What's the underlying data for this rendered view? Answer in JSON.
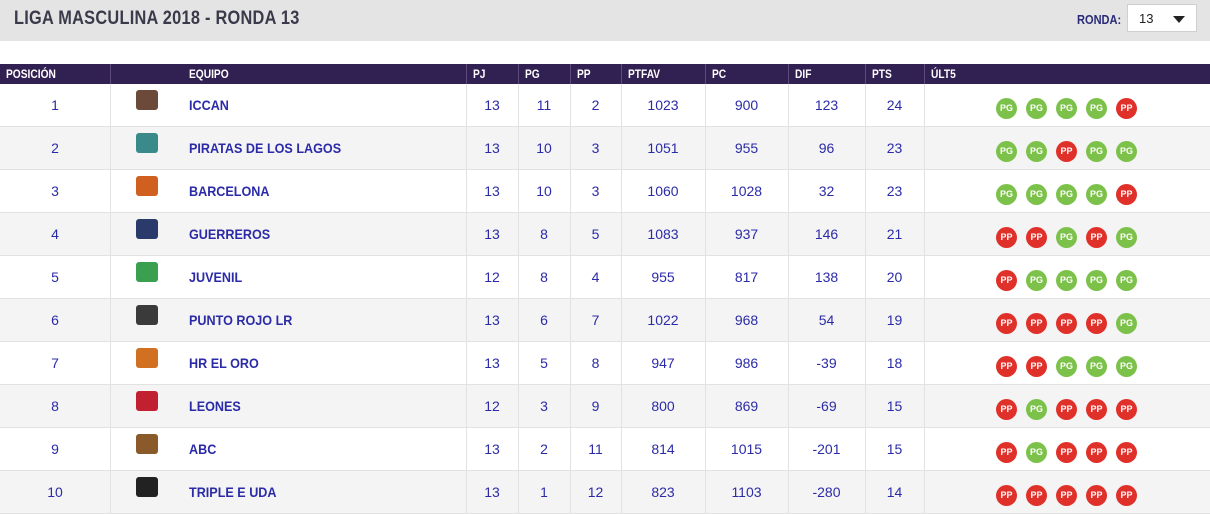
{
  "header": {
    "title": "LIGA MASCULINA 2018 - RONDA 13",
    "ronda_label": "RONDA:",
    "ronda_value": "13"
  },
  "columns": [
    "POSICIÓN",
    "EQUIPO",
    "PJ",
    "PG",
    "PP",
    "PTFAV",
    "PC",
    "DIF",
    "PTS",
    "ÚLT5"
  ],
  "colors": {
    "header_bg": "#312052",
    "link": "#2b2ba8",
    "win": "#7cc24a",
    "loss": "#e0302a"
  },
  "rows": [
    {
      "pos": "1",
      "team": "ICCAN",
      "pj": "13",
      "pg": "11",
      "pp": "2",
      "ptfav": "1023",
      "pc": "900",
      "dif": "123",
      "pts": "24",
      "last5": [
        "PG",
        "PG",
        "PG",
        "PG",
        "PP"
      ],
      "logo_color": "#6b4a3a"
    },
    {
      "pos": "2",
      "team": "PIRATAS DE LOS LAGOS",
      "pj": "13",
      "pg": "10",
      "pp": "3",
      "ptfav": "1051",
      "pc": "955",
      "dif": "96",
      "pts": "23",
      "last5": [
        "PG",
        "PG",
        "PP",
        "PG",
        "PG"
      ],
      "logo_color": "#3a8a8a"
    },
    {
      "pos": "3",
      "team": "BARCELONA",
      "pj": "13",
      "pg": "10",
      "pp": "3",
      "ptfav": "1060",
      "pc": "1028",
      "dif": "32",
      "pts": "23",
      "last5": [
        "PG",
        "PG",
        "PG",
        "PG",
        "PP"
      ],
      "logo_color": "#d06020"
    },
    {
      "pos": "4",
      "team": "GUERREROS",
      "pj": "13",
      "pg": "8",
      "pp": "5",
      "ptfav": "1083",
      "pc": "937",
      "dif": "146",
      "pts": "21",
      "last5": [
        "PP",
        "PP",
        "PG",
        "PP",
        "PG"
      ],
      "logo_color": "#2a3a6a"
    },
    {
      "pos": "5",
      "team": "JUVENIL",
      "pj": "12",
      "pg": "8",
      "pp": "4",
      "ptfav": "955",
      "pc": "817",
      "dif": "138",
      "pts": "20",
      "last5": [
        "PP",
        "PG",
        "PG",
        "PG",
        "PG"
      ],
      "logo_color": "#3aa050"
    },
    {
      "pos": "6",
      "team": "PUNTO ROJO LR",
      "pj": "13",
      "pg": "6",
      "pp": "7",
      "ptfav": "1022",
      "pc": "968",
      "dif": "54",
      "pts": "19",
      "last5": [
        "PP",
        "PP",
        "PP",
        "PP",
        "PG"
      ],
      "logo_color": "#3a3a3a"
    },
    {
      "pos": "7",
      "team": "HR EL ORO",
      "pj": "13",
      "pg": "5",
      "pp": "8",
      "ptfav": "947",
      "pc": "986",
      "dif": "-39",
      "pts": "18",
      "last5": [
        "PP",
        "PP",
        "PG",
        "PG",
        "PG"
      ],
      "logo_color": "#d07020"
    },
    {
      "pos": "8",
      "team": "LEONES",
      "pj": "12",
      "pg": "3",
      "pp": "9",
      "ptfav": "800",
      "pc": "869",
      "dif": "-69",
      "pts": "15",
      "last5": [
        "PP",
        "PG",
        "PP",
        "PP",
        "PP"
      ],
      "logo_color": "#c02030"
    },
    {
      "pos": "9",
      "team": "ABC",
      "pj": "13",
      "pg": "2",
      "pp": "11",
      "ptfav": "814",
      "pc": "1015",
      "dif": "-201",
      "pts": "15",
      "last5": [
        "PP",
        "PG",
        "PP",
        "PP",
        "PP"
      ],
      "logo_color": "#8a5a2a"
    },
    {
      "pos": "10",
      "team": "TRIPLE E UDA",
      "pj": "13",
      "pg": "1",
      "pp": "12",
      "ptfav": "823",
      "pc": "1103",
      "dif": "-280",
      "pts": "14",
      "last5": [
        "PP",
        "PP",
        "PP",
        "PP",
        "PP"
      ],
      "logo_color": "#222222"
    }
  ]
}
